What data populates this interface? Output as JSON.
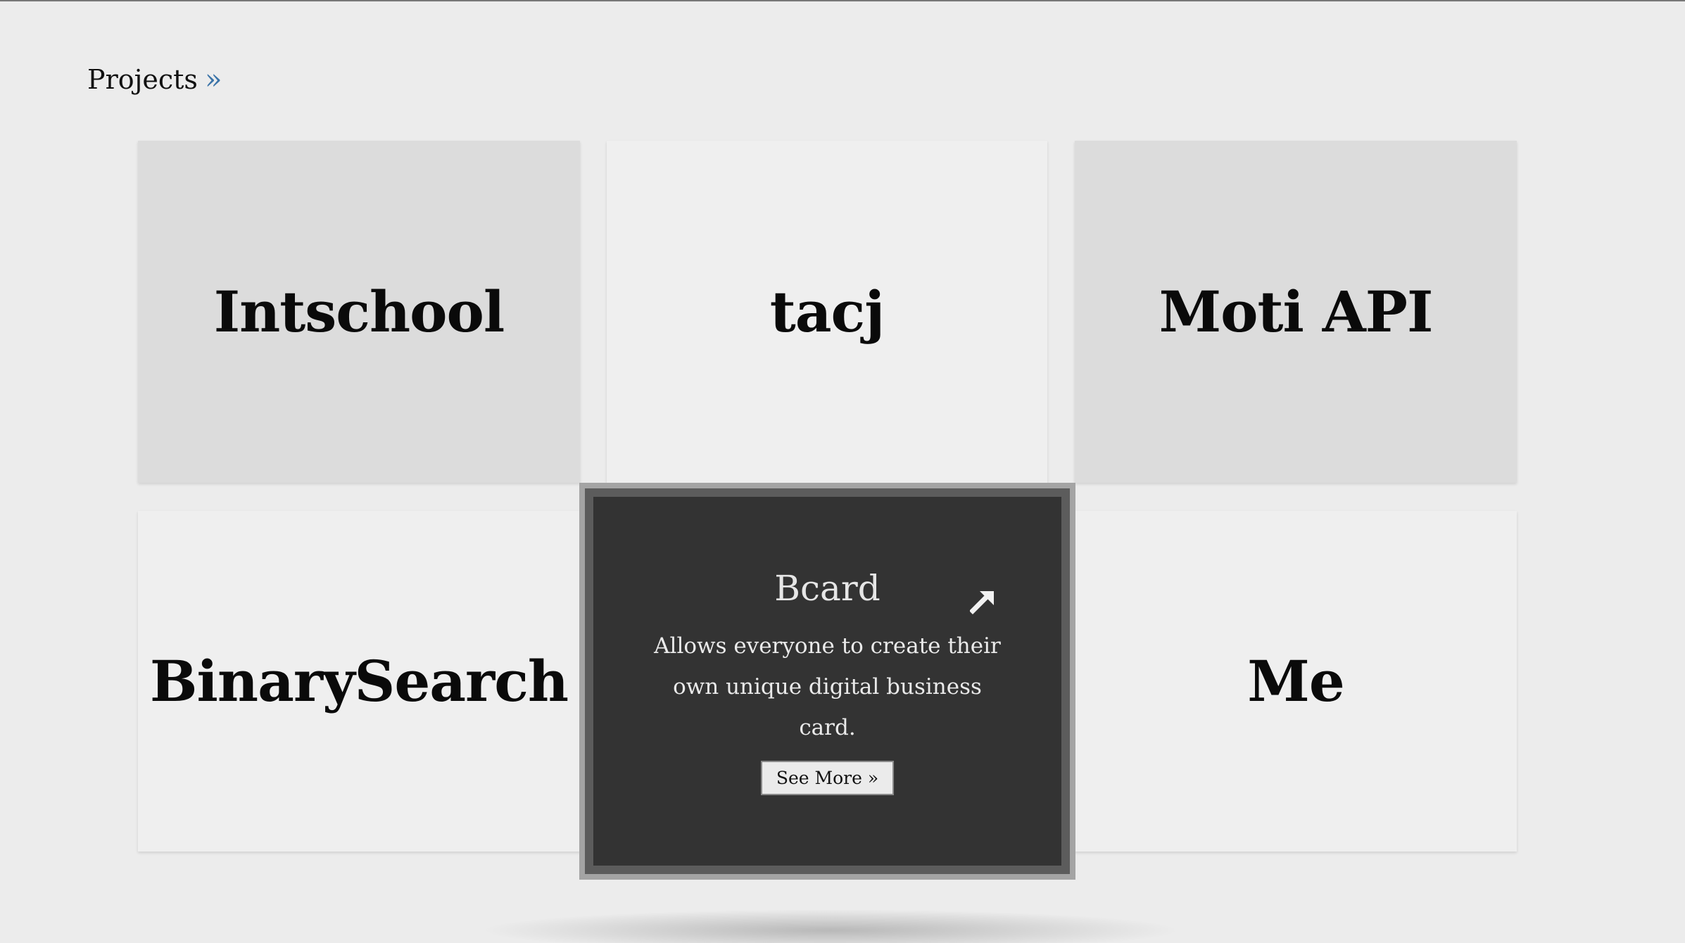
{
  "section": {
    "title": "Projects",
    "arrows": "»"
  },
  "projects": [
    {
      "name": "Intschool"
    },
    {
      "name": "tacj"
    },
    {
      "name": "Moti API"
    },
    {
      "name": "BinarySearch"
    },
    {
      "name": "Me"
    }
  ],
  "featured": {
    "name": "Bcard",
    "description": "Allows everyone to create their own unique digital business card.",
    "button_label": "See More »",
    "icon": "external-link-icon"
  },
  "colors": {
    "background": "#ececec",
    "card_tinted": "#dcdcdc",
    "card_light": "#efefef",
    "featured_bg": "#333333",
    "accent": "#3a73a8"
  }
}
